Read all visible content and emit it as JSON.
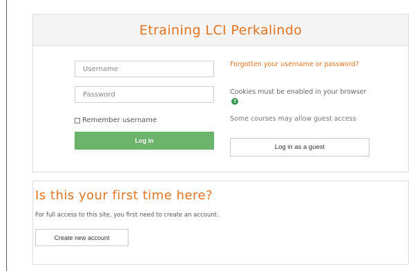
{
  "login": {
    "title": "Etraining LCI Perkalindo",
    "username_placeholder": "Username",
    "password_placeholder": "Password",
    "remember_label": "Remember username",
    "login_button": "Log in",
    "forgot_link": "Forgotten your username or password?",
    "cookies_note": "Cookies must be enabled in your browser",
    "guest_note": "Some courses may allow guest access",
    "guest_button": "Log in as a guest"
  },
  "signup": {
    "title": "Is this your first time here?",
    "text": "For full access to this site, you first need to create an account.",
    "create_button": "Create new account"
  },
  "colors": {
    "accent": "#e2731f",
    "login_button": "#6cb36c",
    "help_icon": "#3c9b52"
  },
  "icons": {
    "help": "question-circle-icon",
    "checkbox": "checkbox-unchecked-icon"
  }
}
